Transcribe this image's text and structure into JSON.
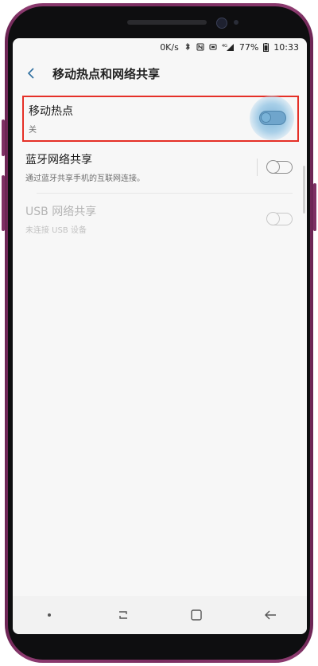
{
  "status_bar": {
    "speed": "0K/s",
    "battery": "77%",
    "time": "10:33"
  },
  "header": {
    "title": "移动热点和网络共享"
  },
  "items": [
    {
      "label": "移动热点",
      "sub": "关",
      "state": "off"
    },
    {
      "label": "蓝牙网络共享",
      "sub": "通过蓝牙共享手机的互联网连接。",
      "state": "off"
    },
    {
      "label": "USB 网络共享",
      "sub": "未连接 USB 设备",
      "state": "disabled"
    }
  ],
  "colors": {
    "highlight_border": "#e53027",
    "phone_frame": "#7a2d60",
    "touch_halo": "#7fb5d9"
  },
  "icons": {
    "back": "chevron-left-icon",
    "nfc": "nfc-icon",
    "bluetooth": "bluetooth-icon",
    "signal": "signal-icon",
    "battery": "battery-icon"
  }
}
